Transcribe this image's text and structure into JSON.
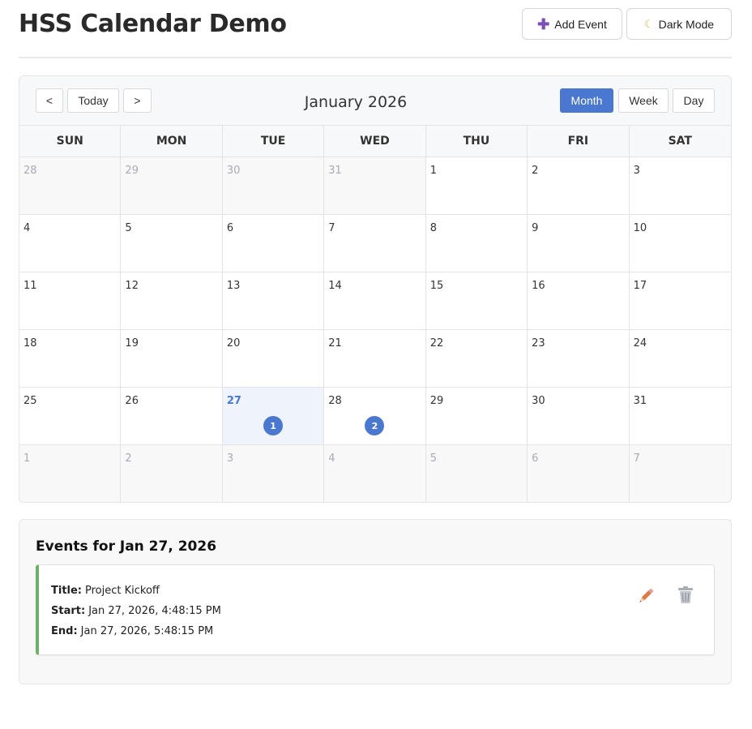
{
  "header": {
    "title": "HSS Calendar Demo",
    "add_event_label": "Add Event",
    "dark_mode_label": "Dark Mode",
    "add_icon": "plus-icon",
    "dark_icon": "moon-icon"
  },
  "toolbar": {
    "prev_label": "<",
    "today_label": "Today",
    "next_label": ">",
    "month_title": "January 2026",
    "views": [
      "Month",
      "Week",
      "Day"
    ],
    "active_view": "Month"
  },
  "weekdays": [
    "SUN",
    "MON",
    "TUE",
    "WED",
    "THU",
    "FRI",
    "SAT"
  ],
  "days": [
    {
      "n": "28",
      "outside": true
    },
    {
      "n": "29",
      "outside": true
    },
    {
      "n": "30",
      "outside": true
    },
    {
      "n": "31",
      "outside": true
    },
    {
      "n": "1"
    },
    {
      "n": "2"
    },
    {
      "n": "3"
    },
    {
      "n": "4"
    },
    {
      "n": "5"
    },
    {
      "n": "6"
    },
    {
      "n": "7"
    },
    {
      "n": "8"
    },
    {
      "n": "9"
    },
    {
      "n": "10"
    },
    {
      "n": "11"
    },
    {
      "n": "12"
    },
    {
      "n": "13"
    },
    {
      "n": "14"
    },
    {
      "n": "15"
    },
    {
      "n": "16"
    },
    {
      "n": "17"
    },
    {
      "n": "18"
    },
    {
      "n": "19"
    },
    {
      "n": "20"
    },
    {
      "n": "21"
    },
    {
      "n": "22"
    },
    {
      "n": "23"
    },
    {
      "n": "24"
    },
    {
      "n": "25"
    },
    {
      "n": "26"
    },
    {
      "n": "27",
      "today": true,
      "events": "1"
    },
    {
      "n": "28",
      "events": "2"
    },
    {
      "n": "29"
    },
    {
      "n": "30"
    },
    {
      "n": "31"
    },
    {
      "n": "1",
      "outside": true
    },
    {
      "n": "2",
      "outside": true
    },
    {
      "n": "3",
      "outside": true
    },
    {
      "n": "4",
      "outside": true
    },
    {
      "n": "5",
      "outside": true
    },
    {
      "n": "6",
      "outside": true
    },
    {
      "n": "7",
      "outside": true
    }
  ],
  "events_panel": {
    "heading": "Events for Jan 27, 2026",
    "event": {
      "title_label": "Title:",
      "title": "Project Kickoff",
      "start_label": "Start:",
      "start": "Jan 27, 2026, 4:48:15 PM",
      "end_label": "End:",
      "end": "Jan 27, 2026, 5:48:15 PM",
      "edit_icon": "pencil-icon",
      "delete_icon": "trash-icon"
    }
  },
  "colors": {
    "accent": "#4a78d0",
    "today_bg": "#eef3fc",
    "event_border": "#6cb06a",
    "plus": "#7b4fb8"
  }
}
